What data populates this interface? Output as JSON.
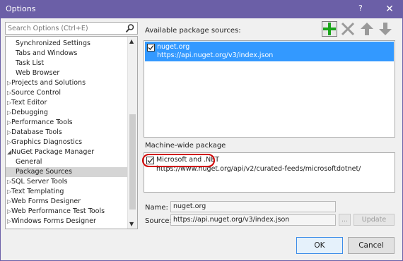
{
  "window": {
    "title": "Options",
    "help_glyph": "?",
    "close_glyph": "✕"
  },
  "search": {
    "placeholder": "Search Options (Ctrl+E)"
  },
  "tree": {
    "items": [
      {
        "label": "Synchronized Settings",
        "caret": ""
      },
      {
        "label": "Tabs and Windows",
        "caret": ""
      },
      {
        "label": "Task List",
        "caret": ""
      },
      {
        "label": "Web Browser",
        "caret": ""
      },
      {
        "label": "Projects and Solutions",
        "caret": "▷"
      },
      {
        "label": "Source Control",
        "caret": "▷"
      },
      {
        "label": "Text Editor",
        "caret": "▷"
      },
      {
        "label": "Debugging",
        "caret": "▷"
      },
      {
        "label": "Performance Tools",
        "caret": "▷"
      },
      {
        "label": "Database Tools",
        "caret": "▷"
      },
      {
        "label": "Graphics Diagnostics",
        "caret": "▷"
      },
      {
        "label": "NuGet Package Manager",
        "caret": "◢"
      },
      {
        "label": "General",
        "caret": ""
      },
      {
        "label": "Package Sources",
        "caret": ""
      },
      {
        "label": "SQL Server Tools",
        "caret": "▷"
      },
      {
        "label": "Text Templating",
        "caret": "▷"
      },
      {
        "label": "Web Forms Designer",
        "caret": "▷"
      },
      {
        "label": "Web Performance Test Tools",
        "caret": "▷"
      },
      {
        "label": "Windows Forms Designer",
        "caret": "▷"
      }
    ]
  },
  "available": {
    "label": "Available package sources:",
    "sources": [
      {
        "name": "nuget.org",
        "url": "https://api.nuget.org/v3/index.json",
        "checked": true
      }
    ]
  },
  "machine": {
    "label": "Machine-wide package",
    "sources": [
      {
        "name": "Microsoft and .NET",
        "url": "https://www.nuget.org/api/v2/curated-feeds/microsoftdotnet/",
        "checked": true
      }
    ]
  },
  "details": {
    "name_label": "Name:",
    "name_value": "nuget.org",
    "source_label": "Source:",
    "source_value": "https://api.nuget.org/v3/index.json",
    "browse_label": "...",
    "update_label": "Update"
  },
  "footer": {
    "ok_label": "OK",
    "cancel_label": "Cancel"
  },
  "colors": {
    "title_bar": "#6b5fa7",
    "selection": "#3399ff",
    "add_icon": "#1aa51a",
    "highlight_ring": "#d10000"
  }
}
